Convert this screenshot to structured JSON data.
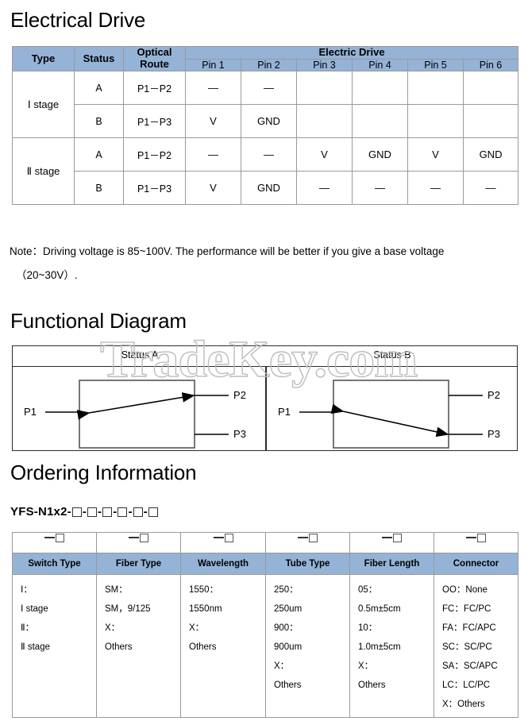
{
  "sections": {
    "electrical_drive": "Electrical Drive",
    "functional_diagram": "Functional Diagram",
    "ordering_information": "Ordering Information"
  },
  "drive_table": {
    "headers": {
      "type": "Type",
      "status": "Status",
      "optical_route": "Optical Route",
      "electric_drive": "Electric Drive",
      "pins": [
        "Pin 1",
        "Pin 2",
        "Pin 3",
        "Pin 4",
        "Pin 5",
        "Pin 6"
      ]
    },
    "rows": [
      {
        "type": "Ⅰ stage",
        "status": "A",
        "optical_route": "P1－P2",
        "pins": [
          "—",
          "—",
          "",
          "",
          "",
          ""
        ]
      },
      {
        "type": "",
        "status": "B",
        "optical_route": "P1－P3",
        "pins": [
          "V",
          "GND",
          "",
          "",
          "",
          ""
        ]
      },
      {
        "type": "Ⅱ stage",
        "status": "A",
        "optical_route": "P1－P2",
        "pins": [
          "—",
          "—",
          "V",
          "GND",
          "V",
          "GND"
        ]
      },
      {
        "type": "",
        "status": "B",
        "optical_route": "P1－P3",
        "pins": [
          "V",
          "GND",
          "—",
          "—",
          "—",
          "—"
        ]
      }
    ]
  },
  "note": {
    "line1": "Note：Driving voltage is 85~100V. The performance will be better if you give a base voltage",
    "line2": "（20~30V）."
  },
  "diagram": {
    "status_a_title": "Status A",
    "status_b_title": "Status B",
    "ports": {
      "p1": "P1",
      "p2": "P2",
      "p3": "P3"
    }
  },
  "ordering": {
    "part_number_prefix": "YFS-N1x2-",
    "part_number_box_count": 6,
    "separator": "-",
    "columns": [
      {
        "header": "Switch Type",
        "options": [
          "Ⅰ：",
          "Ⅰ stage",
          "Ⅱ：",
          "Ⅱ stage"
        ]
      },
      {
        "header": "Fiber Type",
        "options": [
          "SM：",
          "SM，9/125",
          "X：",
          "Others"
        ]
      },
      {
        "header": "Wavelength",
        "options": [
          "1550：",
          "1550nm",
          "X：",
          "Others"
        ]
      },
      {
        "header": "Tube Type",
        "options": [
          "250：",
          "250um",
          "900：",
          "900um",
          "X：",
          "Others"
        ]
      },
      {
        "header": "Fiber Length",
        "options": [
          "05：",
          "0.5m±5cm",
          "10：",
          "1.0m±5cm",
          "X：",
          "Others"
        ]
      },
      {
        "header": "Connector",
        "options": [
          "OO：None",
          "FC：FC/PC",
          "FA：FC/APC",
          "SC：SC/PC",
          "SA：SC/APC",
          "LC：LC/PC",
          "X：Others"
        ]
      }
    ]
  },
  "watermark": {
    "text": "TradeKey.com"
  },
  "colors": {
    "header_blue": "#95b3d7",
    "border_gray": "#9a9a9a",
    "diagram_line": "#2b2b2b",
    "watermark_gray": "#bdbdbd"
  }
}
